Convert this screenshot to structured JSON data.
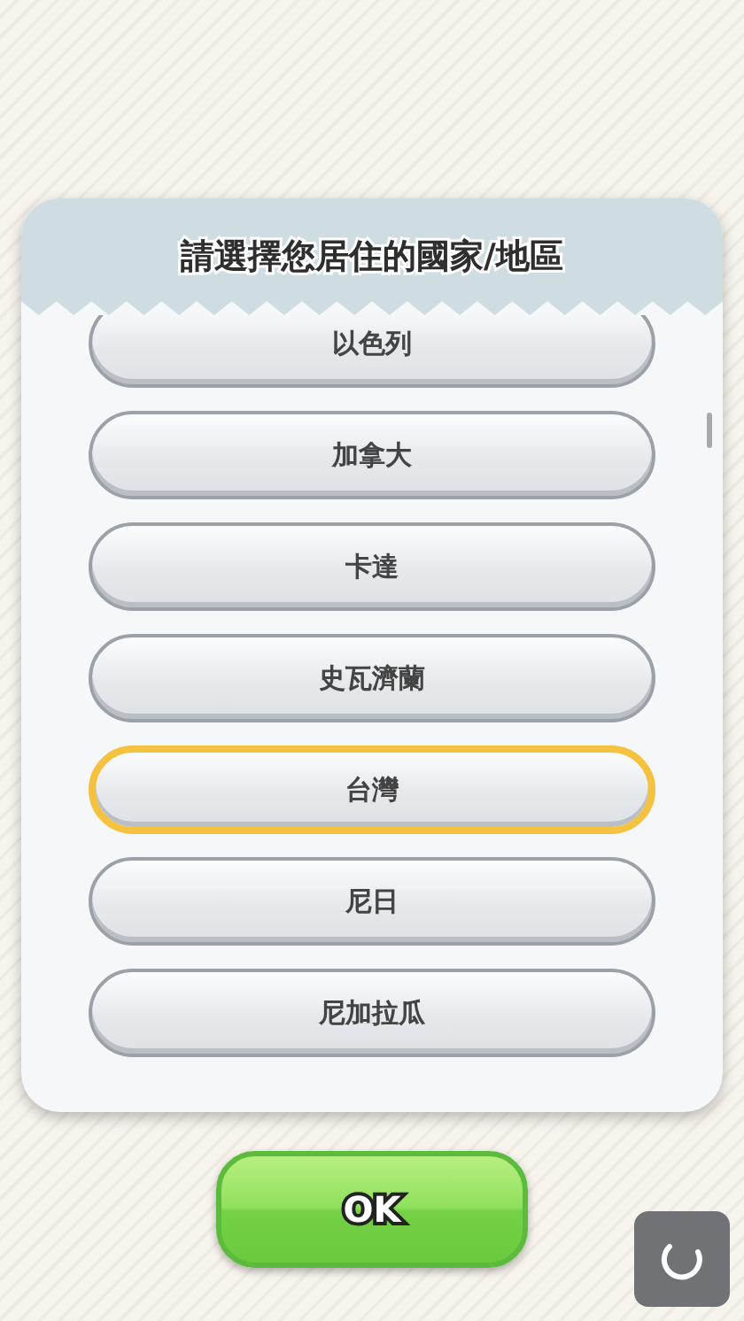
{
  "dialog": {
    "title": "請選擇您居住的國家/地區",
    "options": [
      {
        "label": "以色列",
        "selected": false
      },
      {
        "label": "加拿大",
        "selected": false
      },
      {
        "label": "卡達",
        "selected": false
      },
      {
        "label": "史瓦濟蘭",
        "selected": false
      },
      {
        "label": "台灣",
        "selected": true
      },
      {
        "label": "尼日",
        "selected": false
      },
      {
        "label": "尼加拉瓜",
        "selected": false
      }
    ]
  },
  "ok_button": {
    "label": "OK"
  }
}
